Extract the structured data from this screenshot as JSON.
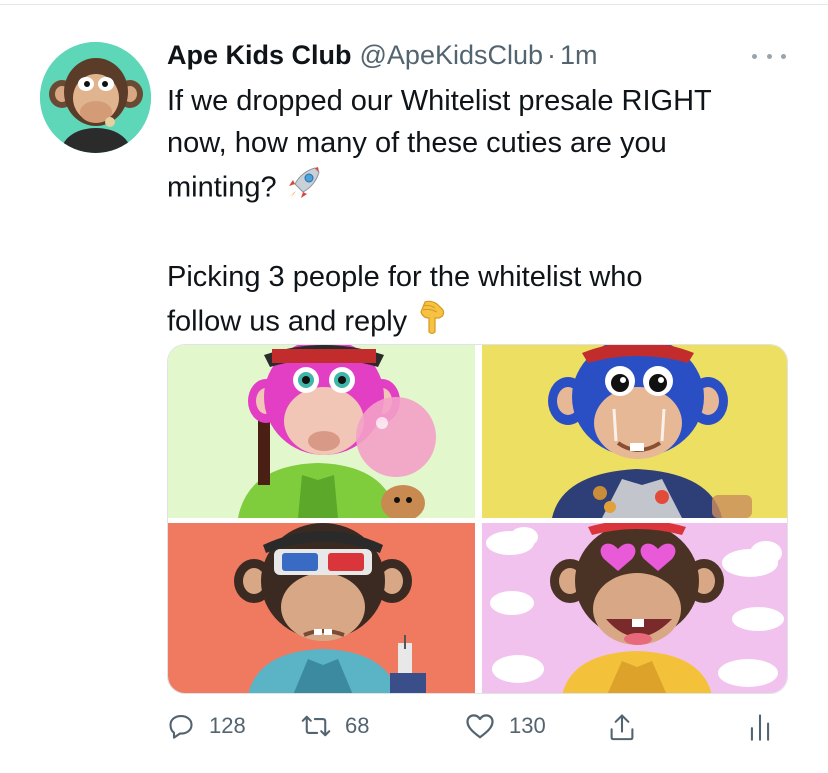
{
  "tweet": {
    "author_name": "Ape Kids Club",
    "handle": "@ApeKidsClub",
    "separator": "·",
    "time": "1m",
    "text_line1": "If we dropped our Whitelist presale RIGHT",
    "text_line2": "now, how many of these cuties are you",
    "text_line3": "minting?",
    "text_line4": "Picking 3 people for the whitelist who",
    "text_line5": "follow us and reply",
    "emoji_1": "rocket-icon",
    "emoji_2": "pointing-down-icon"
  },
  "media": {
    "images": [
      {
        "name": "pink-ape-bubblegum",
        "bg": "#e2f7cc"
      },
      {
        "name": "blue-ape-smiling",
        "bg": "#ecdf62"
      },
      {
        "name": "ape-3d-glasses",
        "bg": "#ef7a60"
      },
      {
        "name": "ape-heart-eyes",
        "bg": "#f2c2ef"
      }
    ]
  },
  "actions": {
    "replies": "128",
    "retweets": "68",
    "likes": "130"
  },
  "colors": {
    "text": "#0f1419",
    "secondary": "#536471",
    "avatar_bg": "#5ed6b8"
  }
}
